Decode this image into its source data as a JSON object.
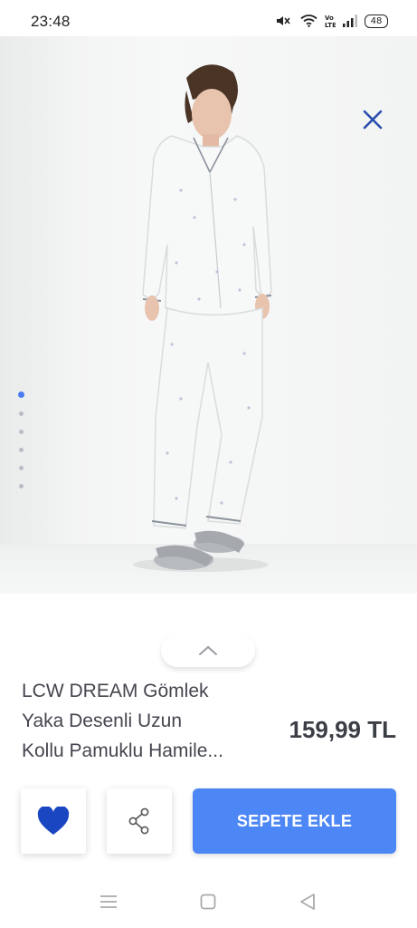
{
  "status_bar": {
    "time": "23:48",
    "battery": "48",
    "icons": [
      "mute-icon",
      "wifi-icon",
      "volte-icon",
      "signal-icon",
      "battery-icon"
    ]
  },
  "gallery": {
    "image_count": 6,
    "active_index": 0,
    "close_icon": "close-icon"
  },
  "product": {
    "title_lines": [
      "LCW DREAM Gömlek",
      "Yaka Desenli Uzun",
      "Kollu Pamuklu Hamile..."
    ],
    "price": "159,99 TL"
  },
  "actions": {
    "favorite_icon": "heart-icon",
    "share_icon": "share-icon",
    "add_to_cart_label": "SEPETE EKLE"
  },
  "colors": {
    "accent": "#4d87f6",
    "heart": "#1b46c2",
    "close": "#2a4fae",
    "text": "#45464f"
  },
  "nav_bar": {
    "icons": [
      "menu-icon",
      "home-icon",
      "back-icon"
    ]
  }
}
